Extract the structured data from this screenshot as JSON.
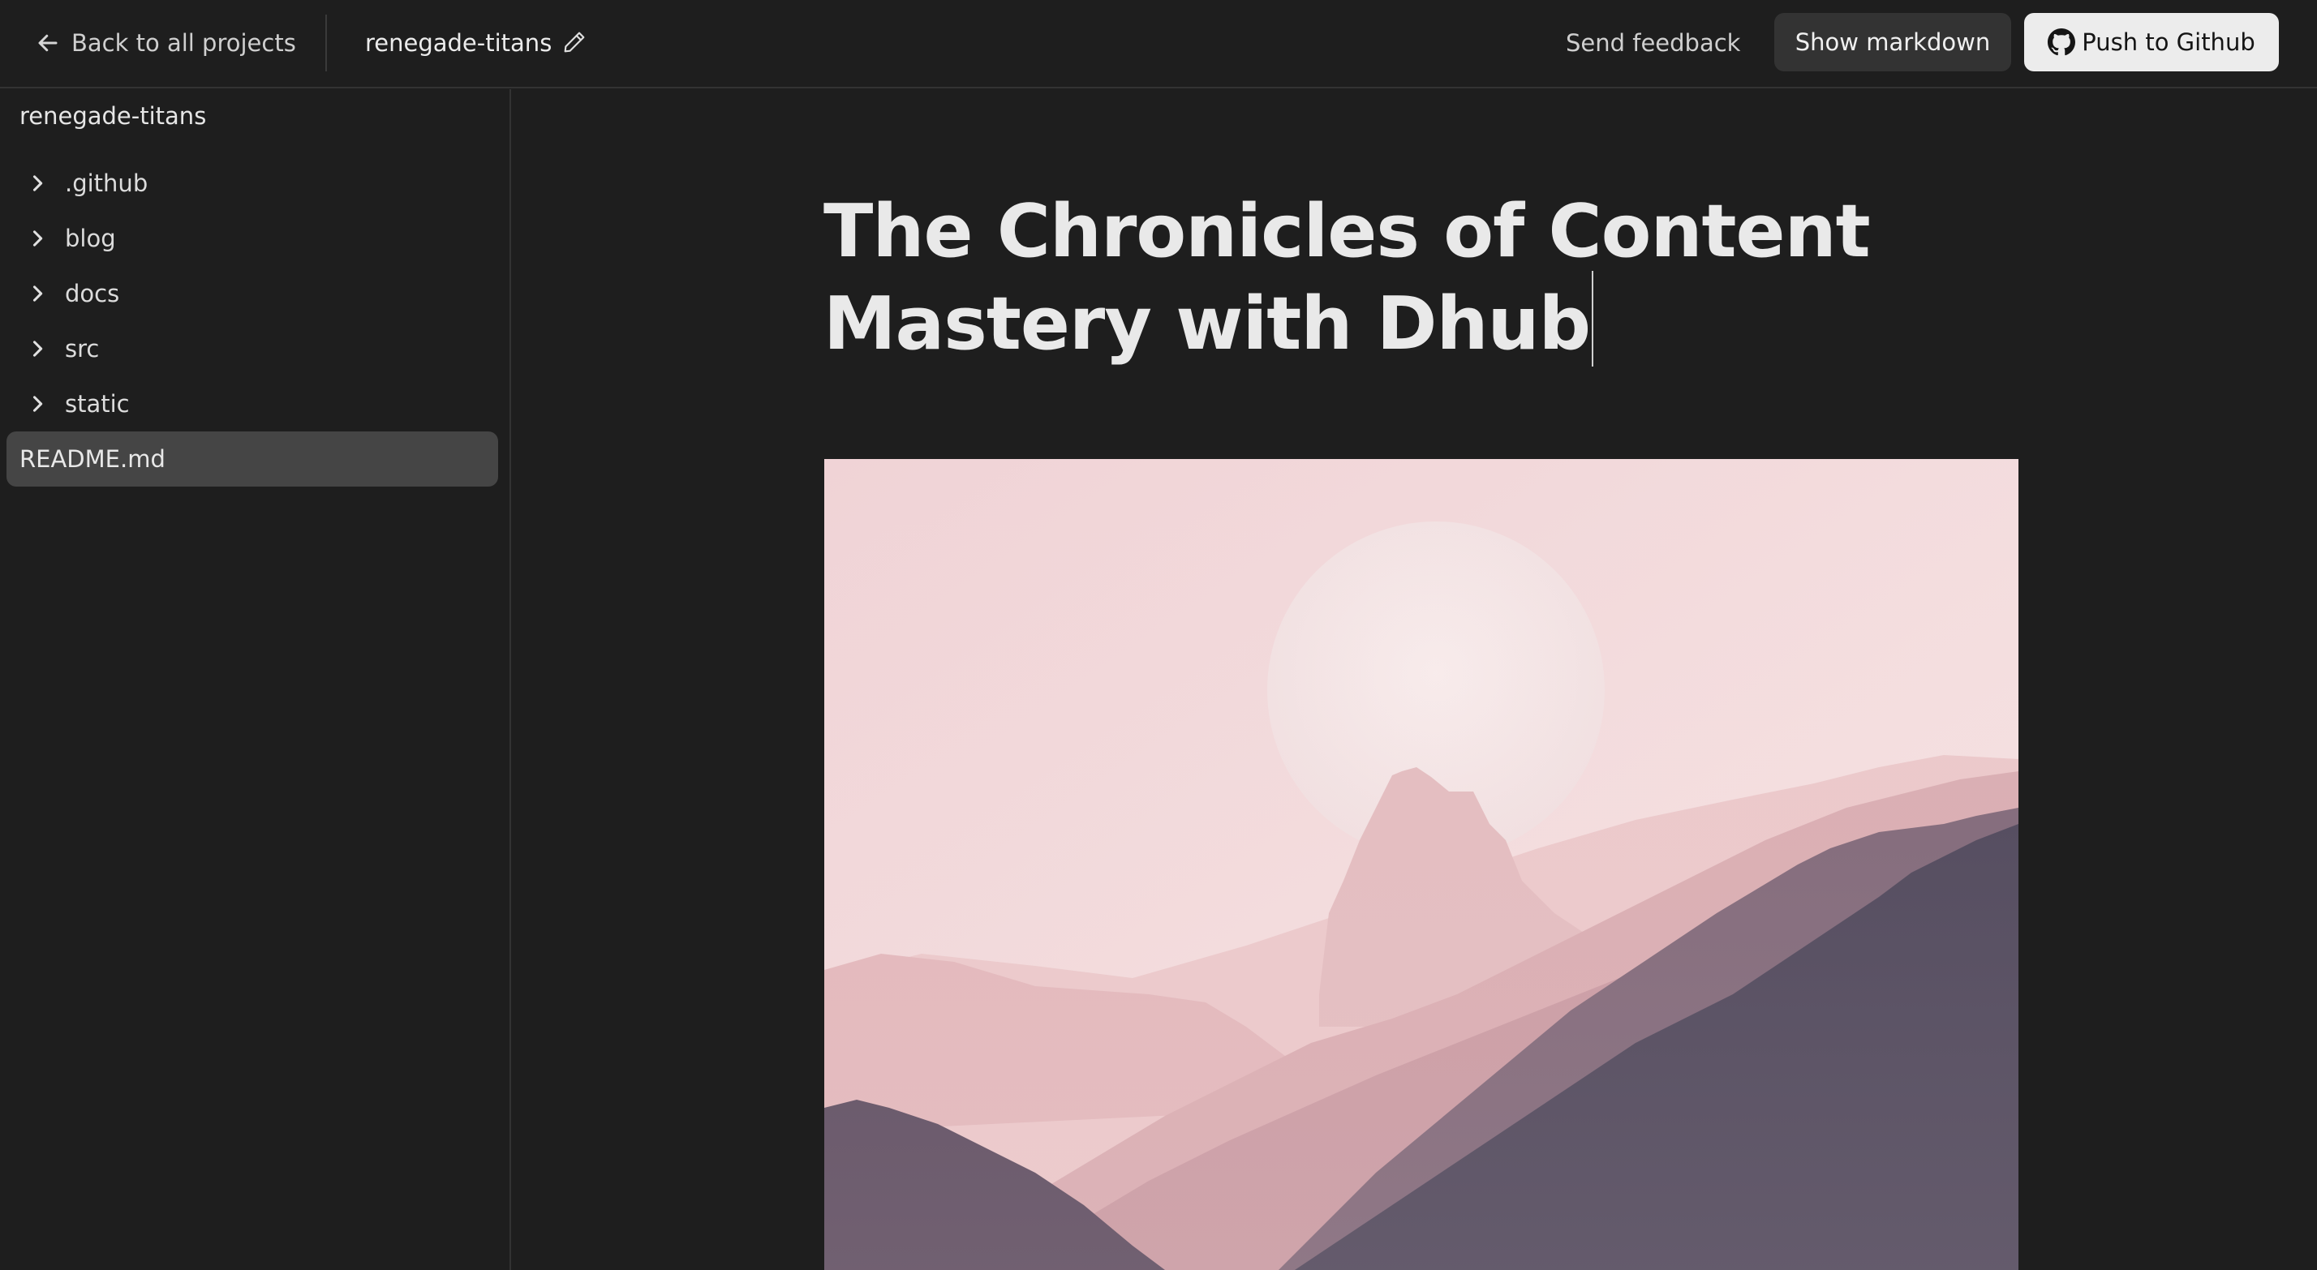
{
  "header": {
    "back_label": "Back to all projects",
    "project_name": "renegade-titans",
    "feedback_label": "Send feedback",
    "markdown_label": "Show markdown",
    "push_label": "Push to Github"
  },
  "sidebar": {
    "root_label": "renegade-titans",
    "folders": [
      {
        "label": ".github"
      },
      {
        "label": "blog"
      },
      {
        "label": "docs"
      },
      {
        "label": "src"
      },
      {
        "label": "static"
      }
    ],
    "selected_file": "README.md"
  },
  "document": {
    "title": "The Chronicles of Content Mastery with Dhub"
  },
  "colors": {
    "background": "#1e1e1e",
    "selected_item": "#454545",
    "primary_button": "#ececec",
    "secondary_button": "#333333"
  },
  "icons": {
    "back": "arrow-left-icon",
    "edit": "pencil-icon",
    "github": "github-icon",
    "folder_chevron": "chevron-right-icon"
  }
}
